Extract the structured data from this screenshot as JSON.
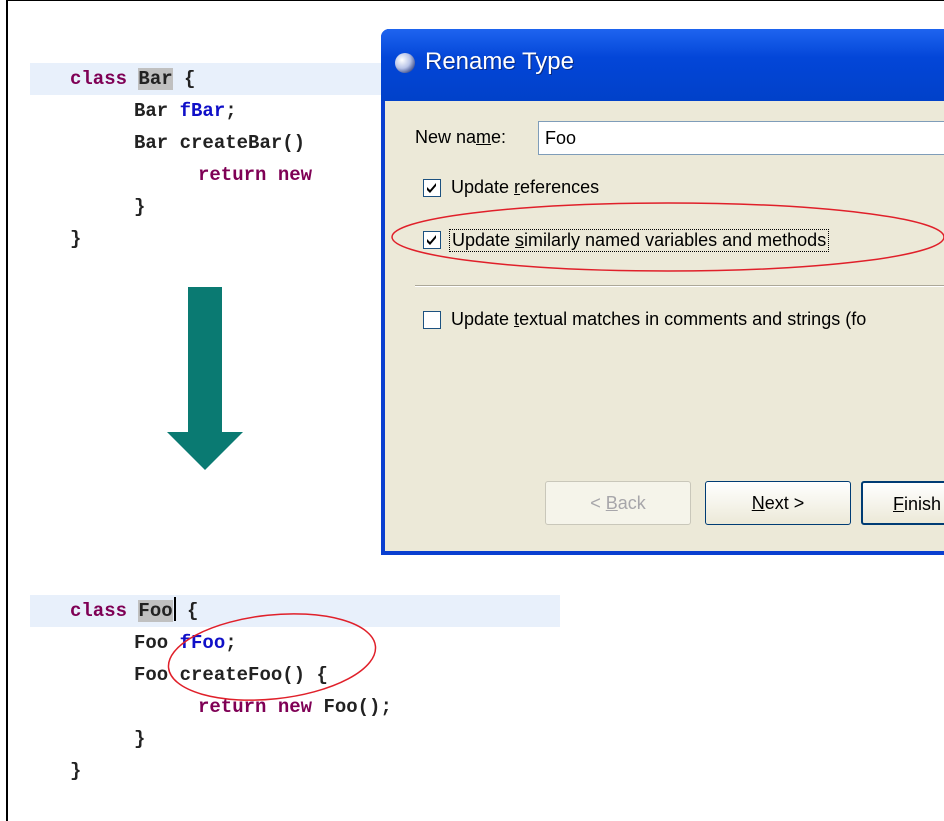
{
  "code_before": {
    "line1": {
      "kw": "class",
      "name": "Bar",
      "rest": " {"
    },
    "line2": {
      "type": "Bar",
      "field": "fBar",
      "rest": ";"
    },
    "line3": {
      "type": "Bar",
      "method": "createBar()"
    },
    "line4": {
      "kw": "return new"
    },
    "line5": "}",
    "line6": "}"
  },
  "code_after": {
    "line1": {
      "kw": "class",
      "name": "Foo",
      "rest": " {"
    },
    "line2": {
      "type": "Foo",
      "field": "fFoo",
      "rest": ";"
    },
    "line3": {
      "type": "Foo",
      "method": "createFoo() {"
    },
    "line4": {
      "kw": "return new",
      "rest": "Foo();"
    },
    "line5": "}",
    "line6": "}"
  },
  "dialog": {
    "title": "Rename Type",
    "new_name_label_pre": "New na",
    "new_name_label_u": "m",
    "new_name_label_post": "e:",
    "new_name_value": "Foo",
    "checkboxes": [
      {
        "pre": "Update ",
        "u": "r",
        "post": "eferences",
        "checked": true
      },
      {
        "pre": "Update ",
        "u": "s",
        "post": "imilarly named variables and methods",
        "checked": true
      },
      {
        "pre": "Update ",
        "u": "t",
        "post": "extual matches in comments and strings (fo",
        "checked": false
      }
    ],
    "buttons": {
      "back_pre": "< ",
      "back_u": "B",
      "back_post": "ack",
      "next_u": "N",
      "next_post": "ext >",
      "finish_u": "F",
      "finish_post": "inish"
    }
  },
  "colors": {
    "arrow": "#0a7a72",
    "keyword": "#7f0055",
    "field": "#1010c8",
    "annotation": "#e0202a"
  }
}
